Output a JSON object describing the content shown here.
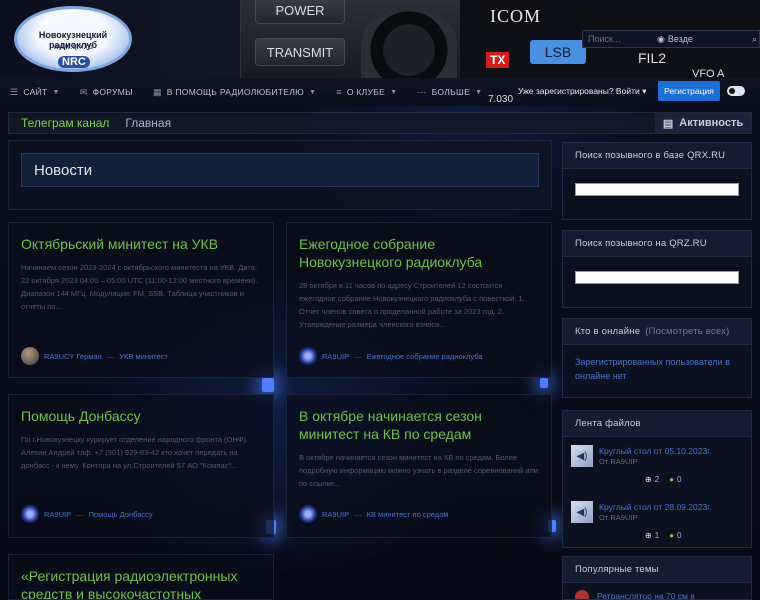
{
  "logo": {
    "title": "Новокузнецкий радиоклуб",
    "url": "www.qrx.ru",
    "badge": "NRC"
  },
  "header_art": {
    "power": "POWER",
    "transmit": "TRANSMIT",
    "brand": "ICOM",
    "mode": "LSB",
    "filter": "FIL2",
    "tx": "TX",
    "vfo": "VFO A",
    "freq": "7.030"
  },
  "search": {
    "placeholder": "Поиск...",
    "scope": "Везде"
  },
  "nav": {
    "items": [
      {
        "label": "САЙТ",
        "icon": "menu-icon"
      },
      {
        "label": "ФОРУМЫ",
        "icon": "forum-icon"
      },
      {
        "label": "В ПОМОЩЬ РАДИОЛЮБИТЕЛЮ",
        "icon": "book-icon"
      },
      {
        "label": "О КЛУБЕ",
        "icon": "list-icon"
      },
      {
        "label": "БОЛЬШЕ",
        "icon": "more-icon"
      }
    ],
    "login": "Уже зарегистрированы? Войти",
    "register": "Регистрация"
  },
  "breadcrumb": {
    "telegram": "Телеграм канал",
    "home": "Главная",
    "activity": "Активность"
  },
  "news": {
    "title": "Новости",
    "cards": [
      {
        "title": "Октябрьский минитест на УКВ",
        "body": "Начинаем сезон 2023-2024 с октябрьского минитеста на УКВ. Дата: 22 октября 2023 04:00 – 05:00 UTC (11:00-12:00 местного времени). Диапазон 144 МГц. Модуляция: FM, SSB. Таблица участников и отчеты по...",
        "author": "RA9UCY Герман",
        "topic": "УКВ минитест"
      },
      {
        "title": "Ежегодное собрание Новокузнецкого радиоклуба",
        "body": "28 октября в 11 часов по адресу Строителей 12 состоится ежегодное собрание Новокузнецкого радиоклуба с повесткой: 1. Отчет членов совета о проделанной работе за 2023 год. 2. Утверждение размера членского взноса...",
        "author": "RA9UIP",
        "topic": "Ежегодное собрание радиоклуба"
      },
      {
        "title": "Помощь Донбассу",
        "body": "По г.Новокузнецку курирует отделение народного фронта (ОНФ) Алехин Андрей тлф. +7 (901) 929-83-42 кто хочет передать на донбасс - к нему. Контора на ул.Строителей 57 АО \"Компас\"...",
        "author": "RA9UIP",
        "topic": "Помощь Донбассу"
      },
      {
        "title": "В октябре начинается сезон минитест на КВ по средам",
        "body": "В октябре начинается сезон минитест на КВ по средам. Более подробную информацию можно узнать в разделе соревнований или по ссылке...",
        "author": "RA9UIP",
        "topic": "КВ минитест по средам"
      },
      {
        "title": "«Регистрация радиоэлектронных средств и высокочастотных",
        "body": "",
        "author": "",
        "topic": ""
      }
    ]
  },
  "sidebar": {
    "qrx_title": "Поиск позывного в базе QRX.RU",
    "qrz_title": "Поиск позывного на QRZ.RU",
    "online_title": "Кто в онлайне",
    "online_link": "(Посмотреть всех)",
    "online_text": "Зарегистрированных пользователи в онлайне нет",
    "files_title": "Лента файлов",
    "files": [
      {
        "title": "Круглый стол от 05.10.2023г.",
        "by": "От RA9UIP",
        "downloads": "2",
        "comments": "0"
      },
      {
        "title": "Круглый стол от 28.09.2023г.",
        "by": "От RA9UIP",
        "downloads": "1",
        "comments": "0"
      }
    ],
    "popular_title": "Популярные темы",
    "popular": [
      {
        "title": "Ретранслятор на 70 см в"
      }
    ]
  }
}
